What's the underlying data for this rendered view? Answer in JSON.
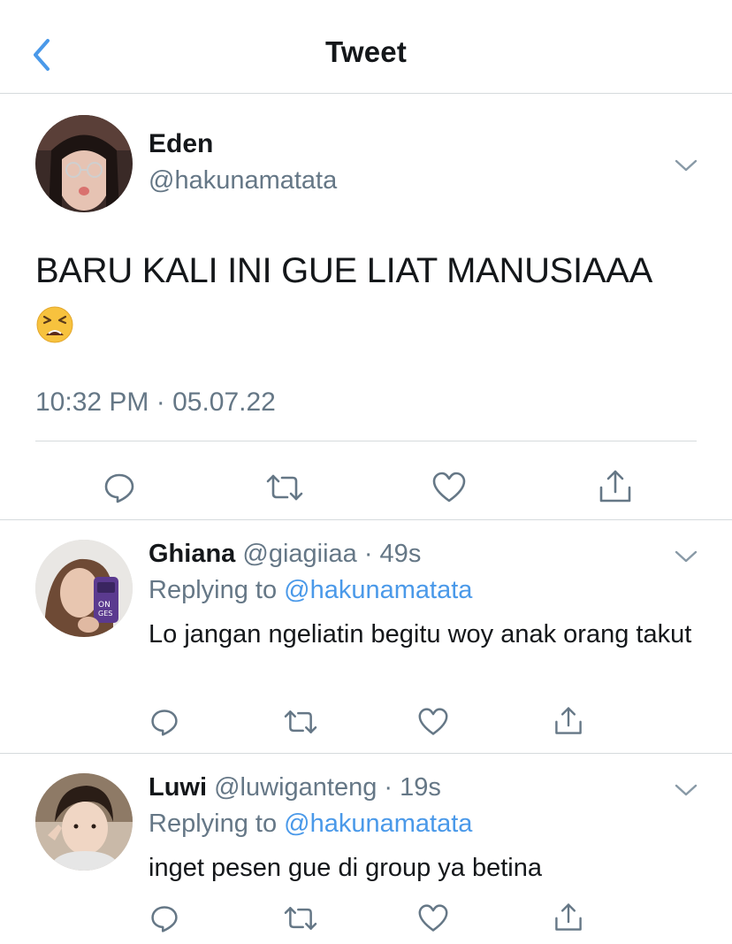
{
  "nav": {
    "title": "Tweet",
    "back_icon": "chevron-left-icon",
    "accent": "#4a99e9"
  },
  "tweet": {
    "name": "Eden",
    "handle": "@hakunamatata",
    "text": "BARU KALI INI GUE LIAT MANUSIAAA",
    "emoji": "tired-face-emoji",
    "timestamp": "10:32 PM · 05.07.22",
    "actions": [
      "reply-icon",
      "retweet-icon",
      "like-icon",
      "share-icon"
    ]
  },
  "replies": [
    {
      "name": "Ghiana",
      "handle": "@giagiiaa · 49s",
      "replying_prefix": "Replying to",
      "replying_to": "@hakunamatata",
      "text": "Lo jangan ngeliatin begitu woy anak orang takut"
    },
    {
      "name": "Luwi",
      "handle": "@luwiganteng · 19s",
      "replying_prefix": "Replying to",
      "replying_to": "@hakunamatata",
      "text": "inget pesen gue di group ya betina"
    }
  ],
  "colors": {
    "text": "#14171a",
    "secondary": "#657786",
    "link": "#4a99e9",
    "divider": "#d6dadd"
  }
}
